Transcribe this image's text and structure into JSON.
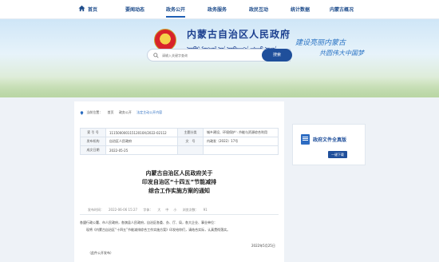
{
  "nav": {
    "items": [
      "首页",
      "要闻动态",
      "政务公开",
      "政务服务",
      "政民互动",
      "统计数据",
      "内蒙古概况"
    ],
    "active": "政务公开"
  },
  "banner": {
    "title": "内蒙古自治区人民政府",
    "title_mongolian": "ᠥᠪᠦᠷ ᠮᠣᠩᠭᠣᠯ ᠤᠨ ᠥᠪᠡᠷᠲᠡᠭᠡᠨ ᠵᠠᠰᠠᠬᠤ ᠣᠷᠣᠨ",
    "slogan_line1": "建设亮丽内蒙古",
    "slogan_line2": "共圆伟大中国梦"
  },
  "search": {
    "placeholder": "请输入关键字查询",
    "button_label": "搜索"
  },
  "breadcrumb": {
    "prefix": "当前位置：",
    "items": [
      "首页",
      "政务公开",
      "法定主动公开内容"
    ]
  },
  "meta_table": {
    "rows": [
      [
        "索 引 号",
        "11150000011512010X/2022-02112",
        "主题分类",
        "城乡建设、环境保护＼节能与资源综合利用"
      ],
      [
        "发布机构",
        "自治区人民政府",
        "文　号",
        "内政发〔2022〕17号"
      ],
      [
        "成文日期",
        "2022-05-25",
        "",
        ""
      ]
    ]
  },
  "document": {
    "title_lines": [
      "内蒙古自治区人民政府关于",
      "印发自治区“十四五”节能减排",
      "综合工作实施方案的通知"
    ],
    "publish_time_label": "发布时间：",
    "publish_time": "2022-06-06 15:27",
    "font_label": "字体：",
    "font_sizes": [
      "大",
      "中",
      "小"
    ],
    "views_label": "浏览次数：",
    "views": "91",
    "paragraphs": [
      "各盟行政公署、市人民政府，各旗县人民政府，自治区各委、办、厅、局，各大企业、事业单位：",
      "　　现将《内蒙古自治区“十四五”节能减排综合工作实施方案》印发给你们，请结合实际，认真贯彻落实。"
    ],
    "date": "2022年5月25日",
    "publish_note": "（此件公开发布）"
  },
  "side_panel": {
    "title": "政府文件全真版",
    "button_label": "一键下载"
  },
  "colors": {
    "primary": "#1f4f9b",
    "link": "#2a6cc0",
    "title_blue": "#1b3f8f"
  }
}
